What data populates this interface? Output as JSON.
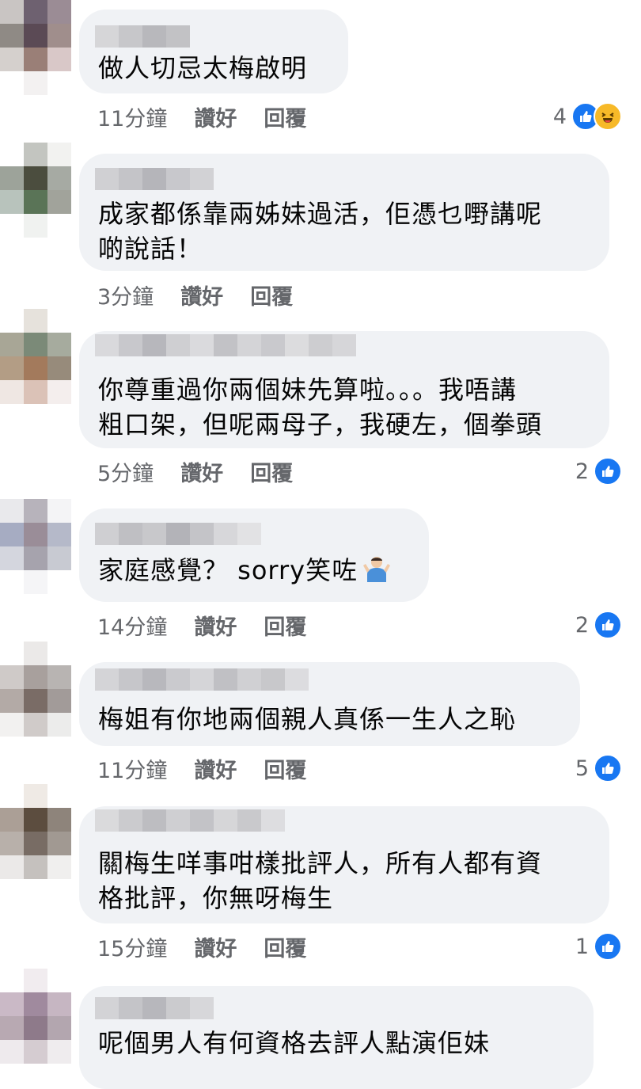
{
  "comments": [
    {
      "text": "做人切忌太梅啟明",
      "time": "11分鐘",
      "like": "讚好",
      "reply": "回覆",
      "reaction_count": "4",
      "reactions": [
        "like-icon",
        "haha-icon"
      ]
    },
    {
      "text": "成家都係靠兩姊妹過活，佢憑乜嘢講呢\n啲說話！",
      "time": "3分鐘",
      "like": "讚好",
      "reply": "回覆",
      "reaction_count": "",
      "reactions": []
    },
    {
      "text": "你尊重過你兩個妹先算啦。。。我唔講\n粗口架，但呢兩母子，我硬左，個拳頭",
      "time": "5分鐘",
      "like": "讚好",
      "reply": "回覆",
      "reaction_count": "2",
      "reactions": [
        "like-icon"
      ]
    },
    {
      "text": "家庭感覺？ sorry笑咗",
      "emoji": "man-shrugging-emoji",
      "time": "14分鐘",
      "like": "讚好",
      "reply": "回覆",
      "reaction_count": "2",
      "reactions": [
        "like-icon"
      ]
    },
    {
      "text": "梅姐有你地兩個親人真係一生人之恥",
      "time": "11分鐘",
      "like": "讚好",
      "reply": "回覆",
      "reaction_count": "5",
      "reactions": [
        "like-icon"
      ]
    },
    {
      "text": "關梅生咩事咁樣批評人，所有人都有資\n格批評，你無呀梅生",
      "time": "15分鐘",
      "like": "讚好",
      "reply": "回覆",
      "reaction_count": "1",
      "reactions": [
        "like-icon"
      ]
    },
    {
      "text": "呢個男人有何資格去評人點演佢妹",
      "time": "",
      "like": "",
      "reply": "",
      "reaction_count": "",
      "reactions": []
    }
  ],
  "colors": {
    "bubble": "#f0f2f5",
    "meta": "#65676b",
    "like_blue": "#1877f2",
    "haha_yellow": "#f7b928"
  }
}
